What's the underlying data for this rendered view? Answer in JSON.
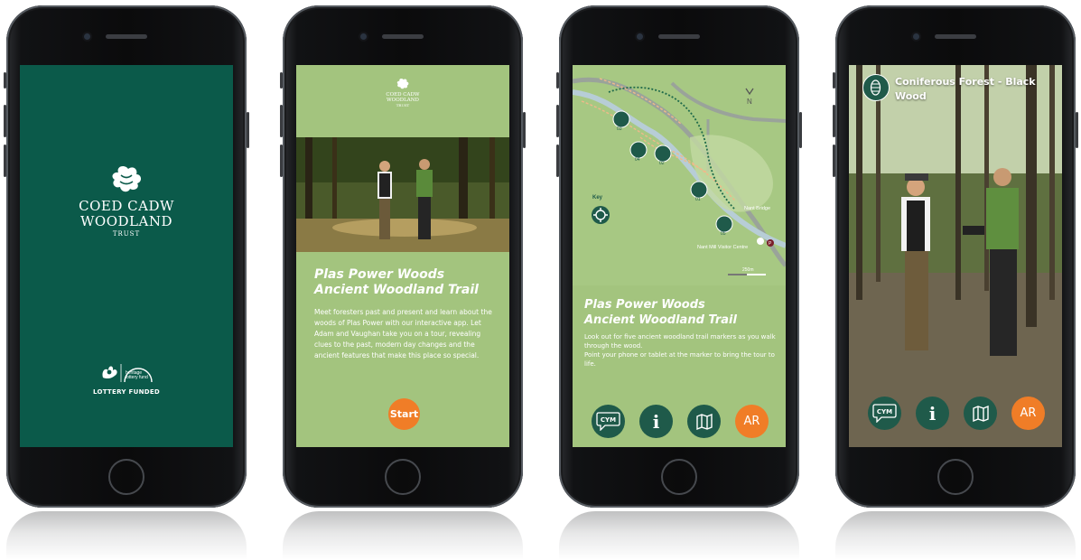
{
  "screen1": {
    "brand_line1": "COED CADW",
    "brand_line2": "WOODLAND",
    "brand_line3": "TRUST",
    "lottery_text": "LOTTERY FUNDED",
    "lottery_logo_text": "heritage lottery fund",
    "background_color": "#0b5a4a"
  },
  "screen2": {
    "logo_line1": "COED CADW",
    "logo_line2": "WOODLAND",
    "logo_line3": "TRUST",
    "title_line1": "Plas Power Woods",
    "title_line2": "Ancient Woodland Trail",
    "body": "Meet foresters past and present and learn about the woods of Plas Power with our interactive app. Let Adam and Vaughan take you on a tour, revealing clues to the past, modern day changes and the ancient features that make this place so special.",
    "start_label": "Start"
  },
  "screen3": {
    "map": {
      "markers": [
        "03",
        "04",
        "02",
        "01",
        "05"
      ],
      "key_label": "Key",
      "bridge_label": "Nant Bridge",
      "visitor_centre_label": "Nant Mill Visitor Centre",
      "parking_label": "P",
      "north_label": "N",
      "scale_label": "250m"
    },
    "title_line1": "Plas Power Woods",
    "title_line2": "Ancient Woodland Trail",
    "body_line1": "Look out for five ancient woodland trail markers as you walk through the wood.",
    "body_line2": "Point your phone or tablet at the marker to bring the tour to life."
  },
  "screen4": {
    "title": "Coniferous Forest - Black Wood"
  },
  "nav": {
    "cym_label": "CYM",
    "info_label": "i",
    "map_icon": "map-icon",
    "ar_label": "AR"
  },
  "colors": {
    "brand_green": "#0b5a4a",
    "leaf_green": "#a3c47e",
    "accent_orange": "#f07d27",
    "nav_dark": "#1f5a4a"
  }
}
